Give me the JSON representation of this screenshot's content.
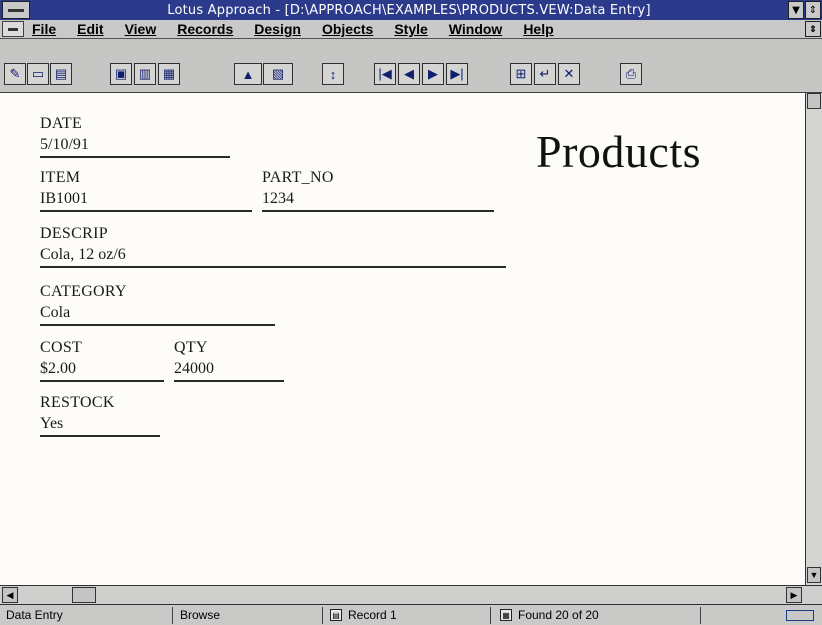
{
  "window": {
    "title": "Lotus Approach - [D:\\APPROACH\\EXAMPLES\\PRODUCTS.VEW:Data Entry]"
  },
  "menu": [
    {
      "label": "File"
    },
    {
      "label": "Edit"
    },
    {
      "label": "View"
    },
    {
      "label": "Records"
    },
    {
      "label": "Design"
    },
    {
      "label": "Objects"
    },
    {
      "label": "Style"
    },
    {
      "label": "Window"
    },
    {
      "label": "Help"
    }
  ],
  "toolbar": {
    "icons": [
      "open-icon",
      "new-icon",
      "folder-icon",
      "print-preview-icon",
      "browse-icon",
      "worksheet-icon",
      "sort-icon",
      "join-icon",
      "find-icon",
      "first-record-icon",
      "prev-record-icon",
      "next-record-icon",
      "last-record-icon",
      "new-record-icon",
      "enter-icon",
      "delete-record-icon",
      "print-icon"
    ]
  },
  "form": {
    "title": "Products",
    "fields": [
      {
        "label": "DATE",
        "value": "5/10/91"
      },
      {
        "label": "ITEM",
        "value": "IB1001"
      },
      {
        "label": "PART_NO",
        "value": "1234"
      },
      {
        "label": "DESCRIP",
        "value": "Cola, 12 oz/6"
      },
      {
        "label": "CATEGORY",
        "value": "Cola"
      },
      {
        "label": "COST",
        "value": "$2.00"
      },
      {
        "label": "QTY",
        "value": "24000"
      },
      {
        "label": "RESTOCK",
        "value": "Yes"
      }
    ]
  },
  "status": {
    "view": "Data Entry",
    "mode": "Browse",
    "record": "Record 1",
    "found": "Found 20 of 20"
  },
  "colors": {
    "titlebar": "#2b3a8a",
    "chrome": "#c9c9c9",
    "form_background": "#fdfcf8"
  }
}
